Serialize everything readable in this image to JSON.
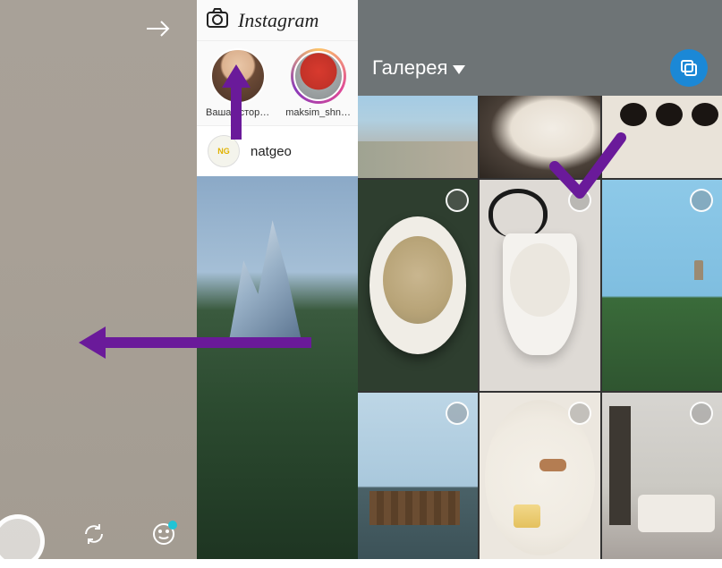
{
  "instagram": {
    "logo": "Instagram",
    "stories": [
      {
        "label": "Ваша истор…"
      },
      {
        "label": "maksim_shn…"
      }
    ],
    "feed_user": "natgeo"
  },
  "gallery": {
    "title": "Галерея"
  },
  "icons": {
    "next_arrow": "next-arrow-icon",
    "camera": "camera-icon",
    "flip": "flip-camera-icon",
    "sticker": "smiley-sticker-icon",
    "caret": "caret-down-icon",
    "multi": "multi-select-icon"
  }
}
